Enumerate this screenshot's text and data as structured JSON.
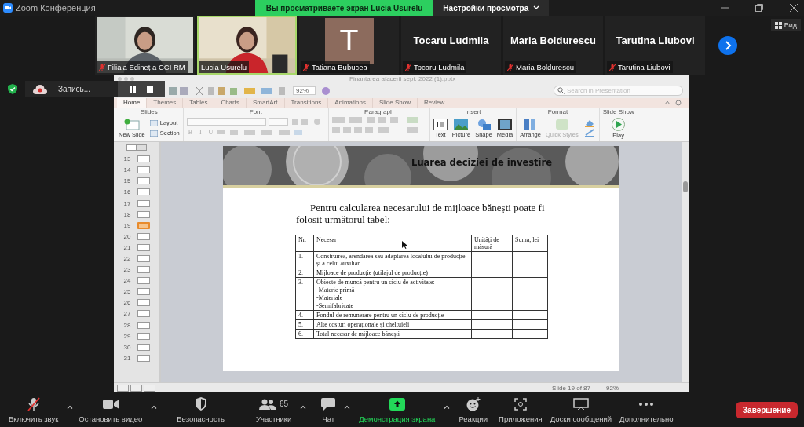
{
  "window": {
    "title": "Zoom Конференция"
  },
  "share_banner": {
    "text": "Вы просматриваете экран Lucia Usurelu",
    "view_options": "Настройки просмотра"
  },
  "gallery": {
    "tiles": [
      {
        "kind": "video",
        "name": "Filiala Edineț a CCI RM",
        "muted": true,
        "speaking": false
      },
      {
        "kind": "video",
        "name": "Lucia Usurelu",
        "muted": false,
        "speaking": true
      },
      {
        "kind": "avatar",
        "initial": "T",
        "name": "Tatiana Bubucea",
        "muted": true,
        "speaking": false
      },
      {
        "kind": "name",
        "display": "Tocaru Ludmila",
        "name": "Tocaru Ludmila",
        "muted": true,
        "speaking": false
      },
      {
        "kind": "name",
        "display": "Maria Boldurescu",
        "name": "Maria Boldurescu",
        "muted": true,
        "speaking": false
      },
      {
        "kind": "name",
        "display": "Tarutina Liubovi",
        "name": "Tarutina Liubovi",
        "muted": true,
        "speaking": false
      }
    ],
    "view_button": "Вид"
  },
  "recording": {
    "label": "Запись..."
  },
  "presentation": {
    "file_title": "Finantarea afacerii sept. 2022 (1).pptx",
    "zoom": "92%",
    "search": {
      "placeholder": "Search in Presentation"
    },
    "tabs": [
      {
        "label": "Home",
        "selected": true
      },
      {
        "label": "Themes",
        "selected": false
      },
      {
        "label": "Tables",
        "selected": false
      },
      {
        "label": "Charts",
        "selected": false
      },
      {
        "label": "SmartArt",
        "selected": false
      },
      {
        "label": "Transitions",
        "selected": false
      },
      {
        "label": "Animations",
        "selected": false
      },
      {
        "label": "Slide Show",
        "selected": false
      },
      {
        "label": "Review",
        "selected": false
      }
    ],
    "groups": {
      "slides": "Slides",
      "font": "Font",
      "paragraph": "Paragraph",
      "insert": "Insert",
      "format": "Format",
      "slide_show": "Slide Show"
    },
    "slide_buttons": {
      "new_slide": "New Slide",
      "layout": "Layout",
      "section": "Section"
    },
    "font_buttons": [
      "B",
      "I",
      "U"
    ],
    "insert_buttons": [
      {
        "kind": "text",
        "label": "Text"
      },
      {
        "kind": "picture",
        "label": "Picture"
      },
      {
        "kind": "shape",
        "label": "Shape"
      },
      {
        "kind": "media",
        "label": "Media"
      }
    ],
    "format_buttons": [
      {
        "kind": "arrange",
        "label": "Arrange"
      },
      {
        "kind": "styles",
        "label": "Quick Styles"
      }
    ],
    "play_button": "Play",
    "thumbnails": [
      {
        "number": "13",
        "selected": false
      },
      {
        "number": "14",
        "selected": false
      },
      {
        "number": "15",
        "selected": false
      },
      {
        "number": "16",
        "selected": false
      },
      {
        "number": "17",
        "selected": false
      },
      {
        "number": "18",
        "selected": false
      },
      {
        "number": "19",
        "selected": true
      },
      {
        "number": "20",
        "selected": false
      },
      {
        "number": "21",
        "selected": false
      },
      {
        "number": "22",
        "selected": false
      },
      {
        "number": "23",
        "selected": false
      },
      {
        "number": "24",
        "selected": false
      },
      {
        "number": "25",
        "selected": false
      },
      {
        "number": "26",
        "selected": false
      },
      {
        "number": "27",
        "selected": false
      },
      {
        "number": "28",
        "selected": false
      },
      {
        "number": "29",
        "selected": false
      },
      {
        "number": "30",
        "selected": false
      },
      {
        "number": "31",
        "selected": false
      }
    ],
    "slide": {
      "title": "Luarea deciziei de investire",
      "paragraph": "Pentru calcularea necesarului de mijloace bănești poate fi folosit următorul tabel:",
      "table": {
        "columns": [
          "Nr.",
          "Necesar",
          "Unități de măsură",
          "Suma, lei"
        ],
        "rows": [
          {
            "nr": "1.",
            "lines": [
              "Construirea, arendarea sau adaptarea localului de producție și a celui auxiliar"
            ]
          },
          {
            "nr": "2.",
            "lines": [
              "Mijloace de producție (utilajul de producție)"
            ]
          },
          {
            "nr": "3.",
            "lines": [
              "Obiecte de muncă pentru un ciclu de activitate:",
              "-Materie primă",
              "-Materiale",
              "-Semifabricate"
            ]
          },
          {
            "nr": "4.",
            "lines": [
              "Fondul de remunerare pentru un ciclu de producție"
            ]
          },
          {
            "nr": "5.",
            "lines": [
              "Alte costuri operaționale și cheltuieli"
            ]
          },
          {
            "nr": "6.",
            "lines": [
              "Total necesar de mijloace bănești"
            ]
          }
        ]
      }
    },
    "status": {
      "slide": "Slide 19 of 87",
      "zoom": "92%"
    }
  },
  "toolbar": {
    "items": [
      {
        "kind": "mic_muted",
        "label": "Включить звук",
        "caret": true
      },
      {
        "kind": "video",
        "label": "Остановить видео",
        "caret": true
      },
      {
        "kind": "security",
        "label": "Безопасность",
        "caret": false
      },
      {
        "kind": "participants",
        "label": "Участники",
        "count": "65",
        "caret": true
      },
      {
        "kind": "chat",
        "label": "Чат",
        "caret": true
      },
      {
        "kind": "share",
        "label": "Демонстрация экрана",
        "caret": true
      },
      {
        "kind": "reactions",
        "label": "Реакции",
        "caret": false
      },
      {
        "kind": "apps",
        "label": "Приложения",
        "caret": false
      },
      {
        "kind": "boards",
        "label": "Доски сообщений",
        "caret": false
      },
      {
        "kind": "more",
        "label": "Дополнительно",
        "caret": false
      }
    ],
    "end_button": "Завершение"
  }
}
